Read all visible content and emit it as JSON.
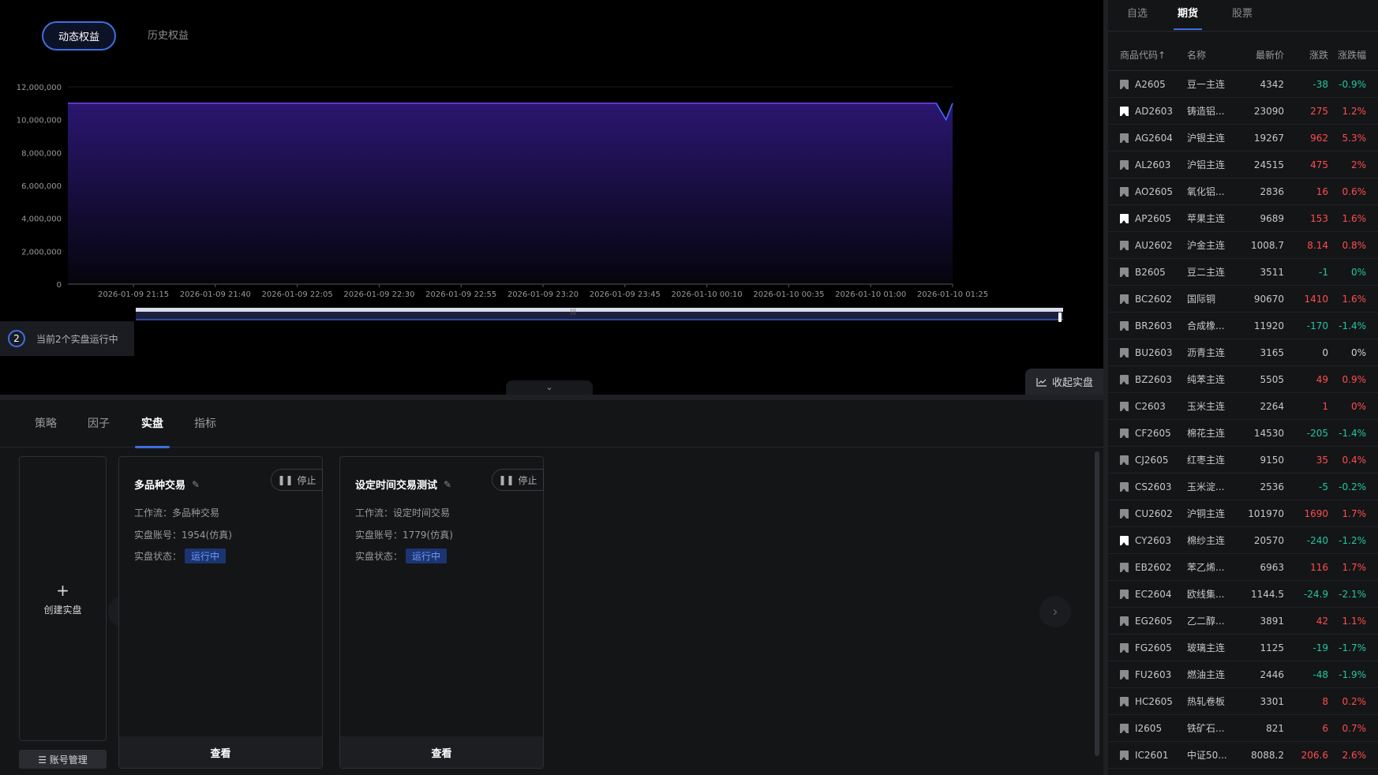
{
  "top_tabs": {
    "active": "动态权益",
    "inactive": "历史权益"
  },
  "running_badge": {
    "count": "2",
    "text": "当前2个实盘运行中"
  },
  "collapse_live": {
    "label": "收起实盘"
  },
  "chart_data": {
    "type": "area",
    "y_ticks": [
      "12,000,000",
      "10,000,000",
      "8,000,000",
      "6,000,000",
      "4,000,000",
      "2,000,000",
      "0"
    ],
    "x_ticks": [
      "2026-01-09 21:15",
      "2026-01-09 21:40",
      "2026-01-09 22:05",
      "2026-01-09 22:30",
      "2026-01-09 22:55",
      "2026-01-09 23:20",
      "2026-01-09 23:45",
      "2026-01-10 00:10",
      "2026-01-10 00:35",
      "2026-01-10 01:00",
      "2026-01-10 01:25"
    ],
    "ylim": [
      0,
      12000000
    ],
    "x": [
      "2026-01-09 20:55",
      "2026-01-09 21:15",
      "2026-01-09 21:40",
      "2026-01-09 22:05",
      "2026-01-09 22:30",
      "2026-01-09 22:55",
      "2026-01-09 23:20",
      "2026-01-09 23:45",
      "2026-01-10 00:10",
      "2026-01-10 00:35",
      "2026-01-10 01:00",
      "2026-01-10 01:20",
      "2026-01-10 01:23",
      "2026-01-10 01:25"
    ],
    "values": [
      11000000,
      11000000,
      11000000,
      11000000,
      11000000,
      11000000,
      11000000,
      11000000,
      11000000,
      11000000,
      11000000,
      11000000,
      10000000,
      11000000
    ],
    "colors": {
      "line": "#7b3ff2",
      "fill_top": "#2a1670",
      "fill_bottom": "#05050c",
      "tail": "#3a6fff"
    },
    "grid": true
  },
  "bottom_tabs": [
    "策略",
    "因子",
    "实盘",
    "指标"
  ],
  "bottom_active_tab": "实盘",
  "create_card": {
    "plus": "+",
    "label": "创建实盘"
  },
  "account_mgmt": {
    "label": "☰ 账号管理"
  },
  "live_cards": [
    {
      "title": "多品种交易",
      "stop": "停止",
      "workflow_label": "工作流：",
      "workflow": "多品种交易",
      "account_label": "实盘账号：",
      "account": "1954(仿真)",
      "status_label": "实盘状态：",
      "status": "运行中",
      "view": "查看"
    },
    {
      "title": "设定时间交易测试",
      "stop": "停止",
      "workflow_label": "工作流：",
      "workflow": "设定时间交易",
      "account_label": "实盘账号：",
      "account": "1779(仿真)",
      "status_label": "实盘状态：",
      "status": "运行中",
      "view": "查看"
    }
  ],
  "market_tabs": [
    "自选",
    "期货",
    "股票"
  ],
  "market_active_tab": "期货",
  "quote_headers": {
    "code": "商品代码↑",
    "name": "名称",
    "price": "最新价",
    "chg": "涨跌",
    "pct": "涨跌幅"
  },
  "quotes": [
    {
      "code": "A2605",
      "name": "豆一主连",
      "price": "4342",
      "chg": "-38",
      "pct": "-0.9%",
      "dir": "down",
      "fav": false
    },
    {
      "code": "AD2603",
      "name": "铸造铝...",
      "price": "23090",
      "chg": "275",
      "pct": "1.2%",
      "dir": "up",
      "fav": true
    },
    {
      "code": "AG2604",
      "name": "沪银主连",
      "price": "19267",
      "chg": "962",
      "pct": "5.3%",
      "dir": "up",
      "fav": false
    },
    {
      "code": "AL2603",
      "name": "沪铝主连",
      "price": "24515",
      "chg": "475",
      "pct": "2%",
      "dir": "up",
      "fav": false
    },
    {
      "code": "AO2605",
      "name": "氧化铝...",
      "price": "2836",
      "chg": "16",
      "pct": "0.6%",
      "dir": "up",
      "fav": false
    },
    {
      "code": "AP2605",
      "name": "苹果主连",
      "price": "9689",
      "chg": "153",
      "pct": "1.6%",
      "dir": "up",
      "fav": true
    },
    {
      "code": "AU2602",
      "name": "沪金主连",
      "price": "1008.7",
      "chg": "8.14",
      "pct": "0.8%",
      "dir": "up",
      "fav": false
    },
    {
      "code": "B2605",
      "name": "豆二主连",
      "price": "3511",
      "chg": "-1",
      "pct": "0%",
      "dir": "down",
      "fav": false
    },
    {
      "code": "BC2602",
      "name": "国际铜",
      "price": "90670",
      "chg": "1410",
      "pct": "1.6%",
      "dir": "up",
      "fav": false
    },
    {
      "code": "BR2603",
      "name": "合成橡...",
      "price": "11920",
      "chg": "-170",
      "pct": "-1.4%",
      "dir": "down",
      "fav": false
    },
    {
      "code": "BU2603",
      "name": "沥青主连",
      "price": "3165",
      "chg": "0",
      "pct": "0%",
      "dir": "flat",
      "fav": false
    },
    {
      "code": "BZ2603",
      "name": "纯苯主连",
      "price": "5505",
      "chg": "49",
      "pct": "0.9%",
      "dir": "up",
      "fav": false
    },
    {
      "code": "C2603",
      "name": "玉米主连",
      "price": "2264",
      "chg": "1",
      "pct": "0%",
      "dir": "up",
      "fav": false
    },
    {
      "code": "CF2605",
      "name": "棉花主连",
      "price": "14530",
      "chg": "-205",
      "pct": "-1.4%",
      "dir": "down",
      "fav": false
    },
    {
      "code": "CJ2605",
      "name": "红枣主连",
      "price": "9150",
      "chg": "35",
      "pct": "0.4%",
      "dir": "up",
      "fav": false
    },
    {
      "code": "CS2603",
      "name": "玉米淀...",
      "price": "2536",
      "chg": "-5",
      "pct": "-0.2%",
      "dir": "down",
      "fav": false
    },
    {
      "code": "CU2602",
      "name": "沪铜主连",
      "price": "101970",
      "chg": "1690",
      "pct": "1.7%",
      "dir": "up",
      "fav": false
    },
    {
      "code": "CY2603",
      "name": "棉纱主连",
      "price": "20570",
      "chg": "-240",
      "pct": "-1.2%",
      "dir": "down",
      "fav": true
    },
    {
      "code": "EB2602",
      "name": "苯乙烯...",
      "price": "6963",
      "chg": "116",
      "pct": "1.7%",
      "dir": "up",
      "fav": false
    },
    {
      "code": "EC2604",
      "name": "欧线集...",
      "price": "1144.5",
      "chg": "-24.9",
      "pct": "-2.1%",
      "dir": "down",
      "fav": false
    },
    {
      "code": "EG2605",
      "name": "乙二醇...",
      "price": "3891",
      "chg": "42",
      "pct": "1.1%",
      "dir": "up",
      "fav": false
    },
    {
      "code": "FG2605",
      "name": "玻璃主连",
      "price": "1125",
      "chg": "-19",
      "pct": "-1.7%",
      "dir": "down",
      "fav": false
    },
    {
      "code": "FU2603",
      "name": "燃油主连",
      "price": "2446",
      "chg": "-48",
      "pct": "-1.9%",
      "dir": "down",
      "fav": false
    },
    {
      "code": "HC2605",
      "name": "热轧卷板",
      "price": "3301",
      "chg": "8",
      "pct": "0.2%",
      "dir": "up",
      "fav": false
    },
    {
      "code": "I2605",
      "name": "铁矿石...",
      "price": "821",
      "chg": "6",
      "pct": "0.7%",
      "dir": "up",
      "fav": false
    },
    {
      "code": "IC2601",
      "name": "中证50...",
      "price": "8088.2",
      "chg": "206.6",
      "pct": "2.6%",
      "dir": "up",
      "fav": false
    }
  ]
}
